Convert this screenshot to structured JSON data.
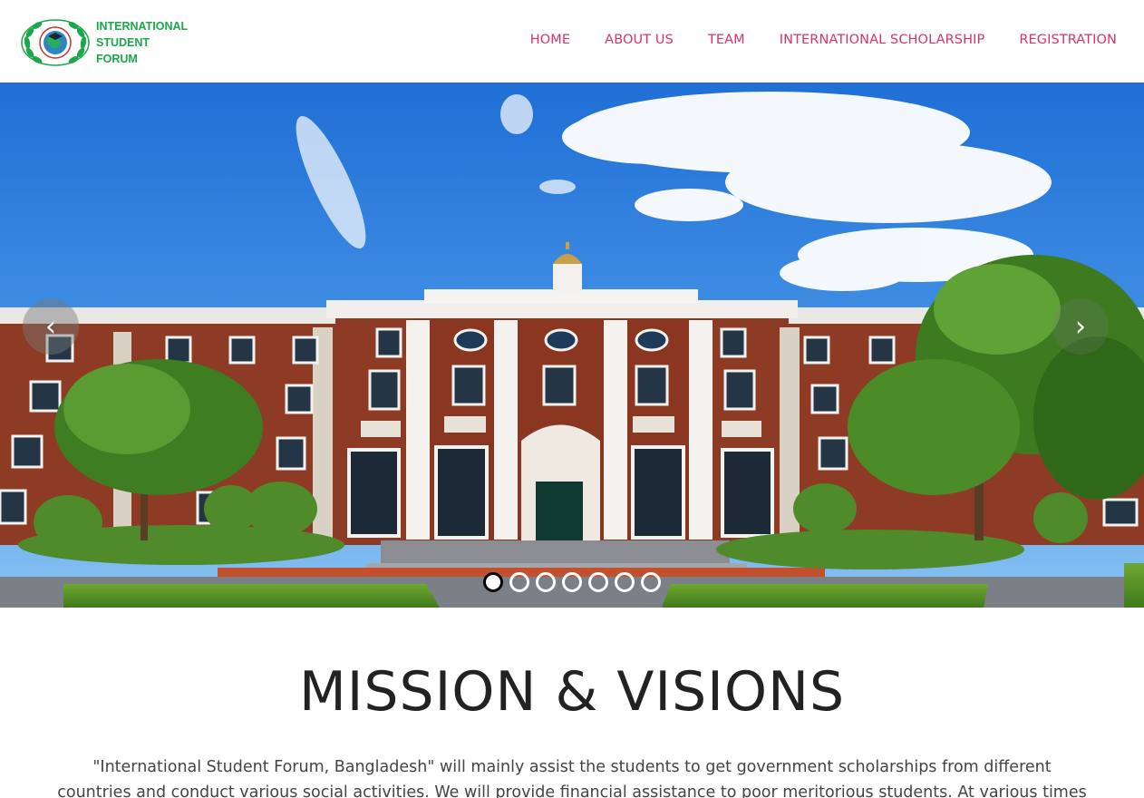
{
  "brand": {
    "name": "INTERNATIONAL\nSTUDENT\nFORUM",
    "accent_color": "#1aa84a"
  },
  "nav": {
    "color": "#d6336c",
    "items": [
      "HOME",
      "ABOUT US",
      "TEAM",
      "INTERNATIONAL SCHOLARSHIP",
      "REGISTRATION"
    ]
  },
  "carousel": {
    "prev_icon": "chevron-left-icon",
    "next_icon": "chevron-right-icon",
    "prev_glyph": "‹",
    "next_glyph": "›",
    "slide_count": 7,
    "active_index": 0,
    "image_description_icon": "university-building-photo"
  },
  "mission": {
    "title": "MISSION & VISIONS",
    "text": "\"International Student Forum, Bangladesh\" will mainly assist the students to get government scholarships from different countries and conduct various social activities. We will provide financial assistance to poor meritorious students. At various times in different"
  }
}
